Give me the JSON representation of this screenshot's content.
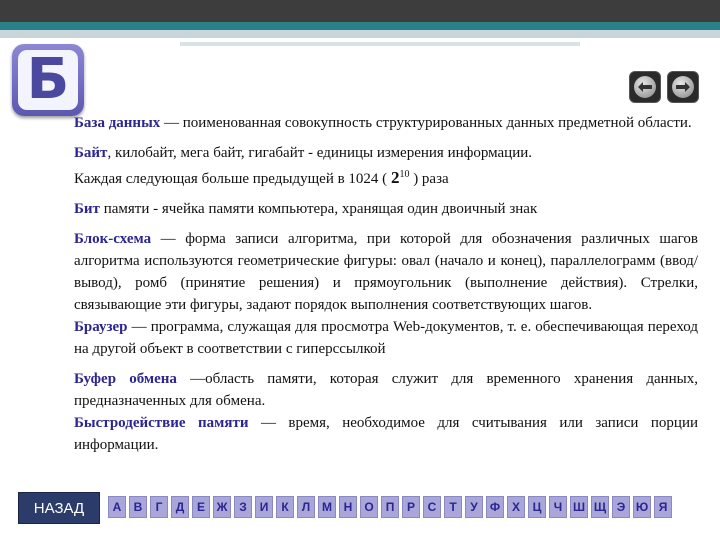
{
  "badge": {
    "letter": "Б"
  },
  "entries": [
    {
      "term": "База данных",
      "text": " — поименованная совокупность структурированных данных предметной области."
    },
    {
      "term": "Байт",
      "text": ", килобайт, мега байт, гигабайт - единицы измерения информации."
    },
    {
      "plain_before": "Каждая следующая больше предыдущей в 1024 ( ",
      "base": "2",
      "exp": "10",
      "plain_after": " ) раза"
    },
    {
      "term": "Бит",
      "text": " памяти - ячейка памяти компьютера, хранящая один двоичный знак"
    },
    {
      "term": "Блок-схема",
      "text": " — форма записи алгоритма, при которой для обозначения различных шагов алгоритма используются геометрические фигуры: овал (начало и конец), параллелограмм (ввод/вывод), ромб (принятие решения) и прямоугольник (выполнение действия). Стрелки, связывающие эти фигуры, задают порядок выполнения соответствующих шагов."
    },
    {
      "term": "Браузер",
      "text": " — программа, служащая для просмотра Web-документов, т. е. обеспечивающая переход на другой объект в соответствии с гиперссылкой"
    },
    {
      "term": "Буфер обмена",
      "text": " —область памяти, которая служит для временного хранения данных, предназначенных для обмена."
    },
    {
      "term": "Быстродействие памяти",
      "text": " — время, необходимое для считывания или записи порции информации."
    }
  ],
  "nav": {
    "back_label": "НАЗАД"
  },
  "alphabet": [
    "А",
    "В",
    "Г",
    "Д",
    "Е",
    "Ж",
    "З",
    "И",
    "К",
    "Л",
    "М",
    "Н",
    "О",
    "П",
    "Р",
    "С",
    "Т",
    "У",
    "Ф",
    "Х",
    "Ц",
    "Ч",
    "Ш",
    "Щ",
    "Э",
    "Ю",
    "Я"
  ]
}
